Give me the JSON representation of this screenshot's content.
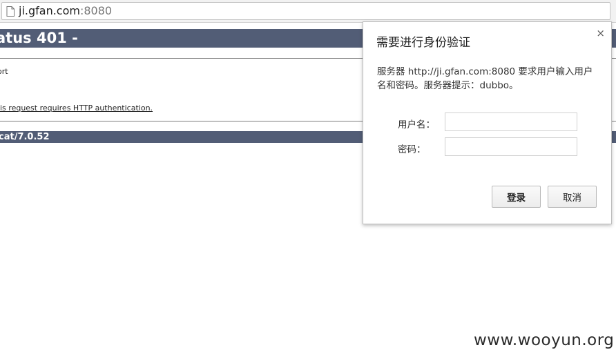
{
  "browser": {
    "url_host": "ji.gfan.com",
    "url_port": ":8080"
  },
  "page": {
    "header": "atus 401 -",
    "type_text": "ort",
    "description": "is request requires HTTP authentication.",
    "footer": "cat/7.0.52"
  },
  "dialog": {
    "title": "需要进行身份验证",
    "close": "×",
    "message": "服务器 http://ji.gfan.com:8080 要求用户输入用户名和密码。服务器提示：dubbo。",
    "username_label": "用户名：",
    "password_label": "密码：",
    "username_value": "",
    "password_value": "",
    "login_button": "登录",
    "cancel_button": "取消"
  },
  "watermark": "www.wooyun.org"
}
